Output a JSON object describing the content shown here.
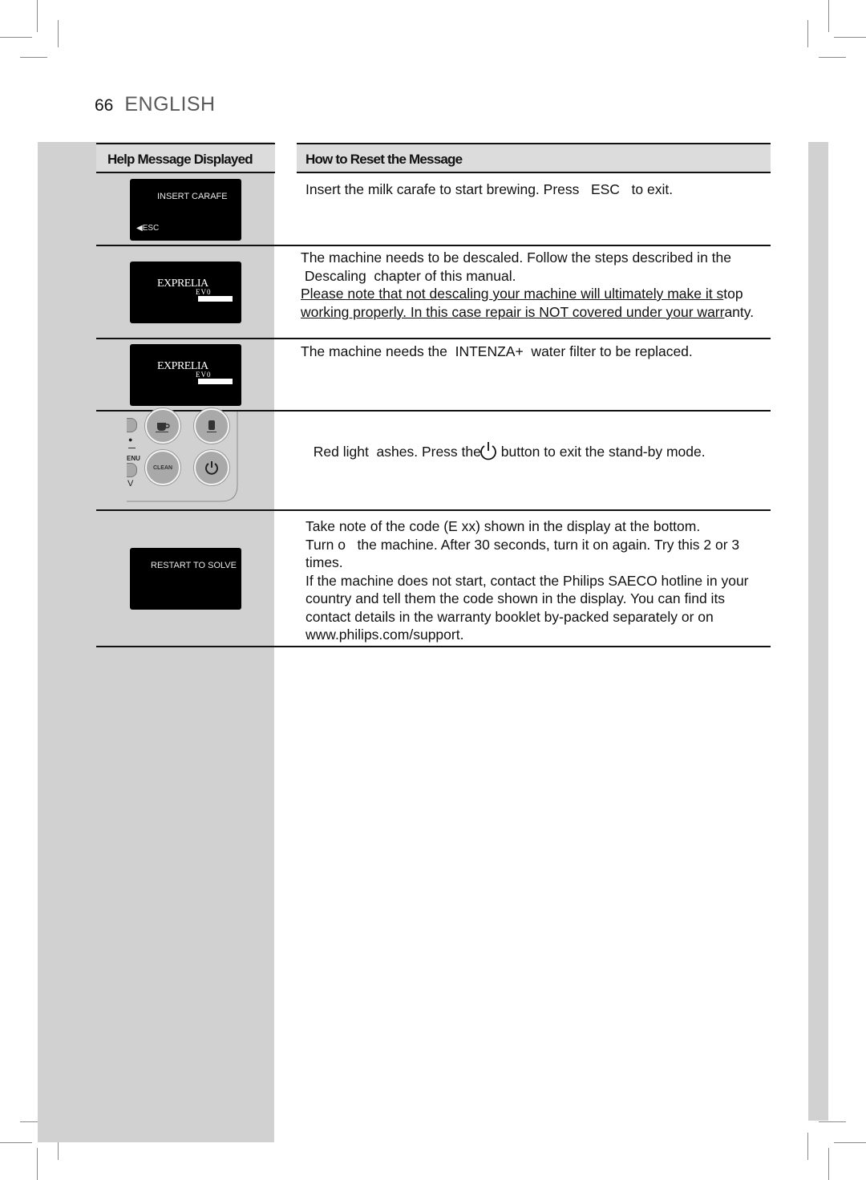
{
  "page": {
    "number": "66",
    "language": "ENGLISH"
  },
  "table": {
    "headers": {
      "left": "Help Message Displayed",
      "right": "How to Reset the Message"
    },
    "rows": [
      {
        "display": {
          "message": "INSERT CARAFE",
          "esc_label": "ESC"
        },
        "instructions": [
          "Insert the milk carafe to start brewing. Press   ESC   to exit."
        ]
      },
      {
        "display": {
          "logo": "EXPRELIA",
          "logo_sub": "EV0"
        },
        "instructions": [
          "The machine needs to be descaled. Follow the steps described in the",
          " Descaling  chapter of this manual."
        ],
        "underlined": [
          "Please note that not descaling your machine will ultimately make it s",
          "working properly. In this case repair is NOT covered under your warr"
        ],
        "underlined_tail": [
          "top",
          "anty."
        ]
      },
      {
        "display": {
          "logo": "EXPRELIA",
          "logo_sub": "EV0"
        },
        "instructions": [
          "The machine needs the  INTENZA+  water filter to be replaced."
        ]
      },
      {
        "display": {
          "panel_labels": {
            "menu": "ENU",
            "down": "V",
            "clean": "CLEAN"
          }
        },
        "instructions_before_icon": "Red light  ashes. Press the",
        "instructions_after_icon": " button to exit the stand-by mode."
      },
      {
        "display": {
          "message": "RESTART TO SOLVE"
        },
        "instructions": [
          "Take note of the code (E xx) shown in the display at the bottom.",
          "Turn o   the machine. After 30 seconds, turn it on again. Try this 2 or 3",
          "times.",
          "If the machine does not start, contact the Philips SAECO hotline in your",
          "country and tell them the code shown in the display. You can find its",
          "contact details in the warranty booklet by-packed separately or on",
          "www.philips.com/support."
        ]
      }
    ]
  }
}
